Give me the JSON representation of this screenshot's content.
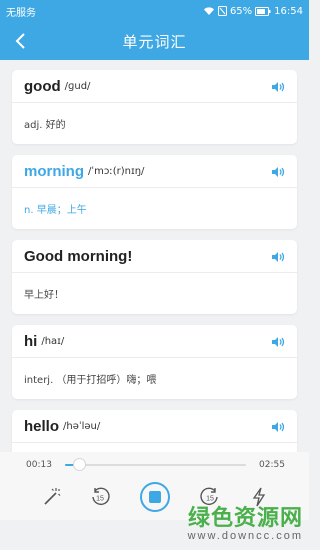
{
  "status_bar": {
    "carrier": "无服务",
    "battery": "65%",
    "time": "16:54"
  },
  "nav": {
    "title": "单元词汇",
    "back_icon": "chevron-left-icon"
  },
  "words": [
    {
      "word": "good",
      "phonetic": "/ɡud/",
      "meaning": "adj. 好的",
      "active": false
    },
    {
      "word": "morning",
      "phonetic": "/ˈmɔː(r)nɪŋ/",
      "meaning": "n. 早晨；上午",
      "active": true
    },
    {
      "word": "Good morning!",
      "phonetic": "",
      "meaning": "早上好！",
      "active": false
    },
    {
      "word": "hi",
      "phonetic": "/haɪ/",
      "meaning": "interj. （用于打招呼）嗨；喂",
      "active": false
    },
    {
      "word": "hello",
      "phonetic": "/həˈləu/",
      "meaning": "",
      "active": false
    }
  ],
  "player": {
    "current_time": "00:13",
    "total_time": "02:55",
    "progress": 0.08,
    "rewind_label": "15",
    "forward_label": "15"
  },
  "watermark": {
    "title": "绿色资源网",
    "url": "www.downcc.com"
  },
  "colors": {
    "accent": "#3ea8e5",
    "background": "#f0f1f3"
  }
}
